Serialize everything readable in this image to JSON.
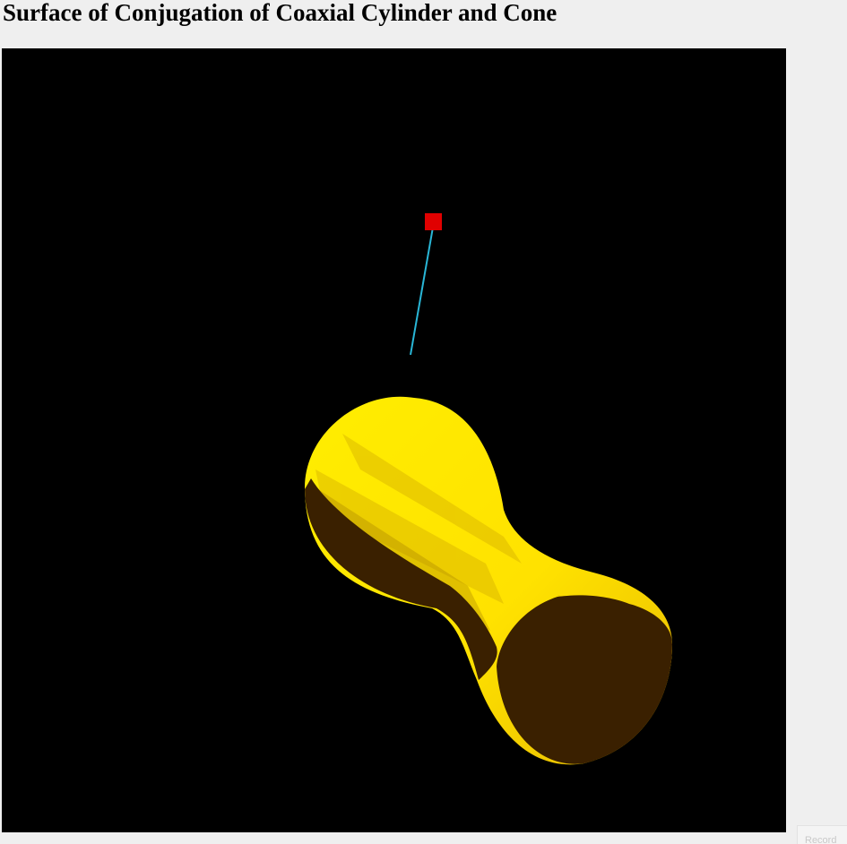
{
  "page": {
    "title": "Surface of Conjugation of Coaxial Cylinder and Cone"
  },
  "scene": {
    "background": "#000000",
    "surface_color": "#ffe000",
    "surface_shadow_color": "#3a2000",
    "light_marker_color": "#e00000",
    "light_ray_color": "#29b6d6"
  },
  "controls": {
    "corner_button_label": "Record"
  }
}
